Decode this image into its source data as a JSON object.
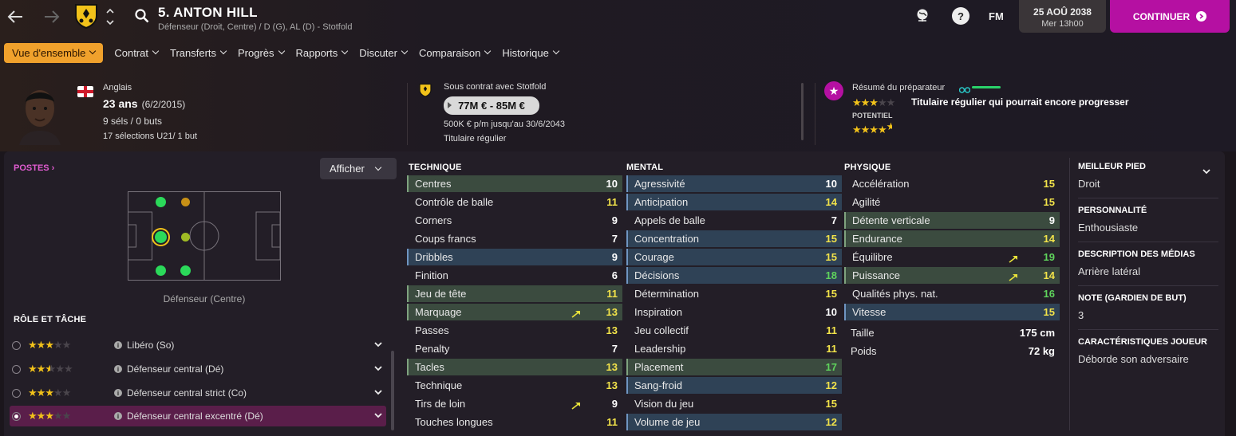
{
  "header": {
    "player_title": "5. ANTON HILL",
    "player_subtitle": "Défenseur (Droit, Centre) / D (G), AL (D) - Stotfold",
    "fm_label": "FM",
    "date": "25 AOÛ 2038",
    "day_time": "Mer 13h00",
    "continue_label": "CONTINUER"
  },
  "nav": {
    "tabs": [
      "Vue d'ensemble",
      "Contrat",
      "Transferts",
      "Progrès",
      "Rapports",
      "Discuter",
      "Comparaison",
      "Historique"
    ]
  },
  "profile": {
    "nationality": "Anglais",
    "age": "23 ans",
    "dob": "(6/2/2015)",
    "caps": "9 séls / 0 buts",
    "u21": "17 sélections U21/ 1 but"
  },
  "contract": {
    "club_line": "Sous contrat avec Stotfold",
    "value": "77M € - 85M €",
    "wage": "500K € p/m jusqu'au 30/6/2043",
    "status": "Titulaire régulier"
  },
  "coach": {
    "title": "Résumé du préparateur",
    "ability_stars": 3,
    "summary": "Titulaire régulier qui pourrait encore progresser",
    "potential_label": "POTENTIEL",
    "potential_stars": 4.5
  },
  "positions": {
    "title": "POSTES",
    "afficher": "Afficher",
    "position_label": "Défenseur (Centre)"
  },
  "roles": {
    "title": "RÔLE ET TÂCHE",
    "items": [
      {
        "name": "Libéro (So)",
        "stars": 3
      },
      {
        "name": "Défenseur central (Dé)",
        "stars": 2.5
      },
      {
        "name": "Défenseur central strict (Co)",
        "stars": 3
      },
      {
        "name": "Défenseur central excentré (Dé)",
        "stars": 3
      }
    ]
  },
  "technique": {
    "title": "TECHNIQUE",
    "attrs": [
      [
        "Centres",
        10,
        "g",
        false
      ],
      [
        "Contrôle de balle",
        11,
        "",
        false
      ],
      [
        "Corners",
        9,
        "",
        false
      ],
      [
        "Coups francs",
        7,
        "",
        false
      ],
      [
        "Dribbles",
        9,
        "b",
        false
      ],
      [
        "Finition",
        6,
        "",
        false
      ],
      [
        "Jeu de tête",
        11,
        "g",
        false
      ],
      [
        "Marquage",
        13,
        "g",
        true
      ],
      [
        "Passes",
        13,
        "",
        false
      ],
      [
        "Penalty",
        7,
        "",
        false
      ],
      [
        "Tacles",
        13,
        "g",
        false
      ],
      [
        "Technique",
        13,
        "",
        false
      ],
      [
        "Tirs de loin",
        9,
        "",
        true
      ],
      [
        "Touches longues",
        11,
        "",
        false
      ]
    ]
  },
  "mental": {
    "title": "MENTAL",
    "attrs": [
      [
        "Agressivité",
        10,
        "b",
        false
      ],
      [
        "Anticipation",
        14,
        "b",
        false
      ],
      [
        "Appels de balle",
        7,
        "",
        false
      ],
      [
        "Concentration",
        15,
        "b",
        false
      ],
      [
        "Courage",
        15,
        "b",
        false
      ],
      [
        "Décisions",
        18,
        "b",
        false
      ],
      [
        "Détermination",
        15,
        "",
        false
      ],
      [
        "Inspiration",
        10,
        "",
        false
      ],
      [
        "Jeu collectif",
        11,
        "",
        false
      ],
      [
        "Leadership",
        11,
        "",
        false
      ],
      [
        "Placement",
        17,
        "g",
        false
      ],
      [
        "Sang-froid",
        12,
        "b",
        false
      ],
      [
        "Vision du jeu",
        15,
        "",
        false
      ],
      [
        "Volume de jeu",
        12,
        "b",
        false
      ]
    ]
  },
  "physique": {
    "title": "PHYSIQUE",
    "attrs": [
      [
        "Accélération",
        15,
        "",
        false
      ],
      [
        "Agilité",
        15,
        "",
        false
      ],
      [
        "Détente verticale",
        9,
        "g",
        false
      ],
      [
        "Endurance",
        14,
        "g",
        false
      ],
      [
        "Équilibre",
        19,
        "",
        true
      ],
      [
        "Puissance",
        14,
        "g",
        true
      ],
      [
        "Qualités phys. nat.",
        16,
        "",
        false
      ],
      [
        "Vitesse",
        15,
        "b",
        false
      ]
    ],
    "height_label": "Taille",
    "height": "175 cm",
    "weight_label": "Poids",
    "weight": "72 kg"
  },
  "info": [
    {
      "title": "MEILLEUR PIED",
      "value": "Droit"
    },
    {
      "title": "PERSONNALITÉ",
      "value": "Enthousiaste"
    },
    {
      "title": "DESCRIPTION DES MÉDIAS",
      "value": "Arrière latéral"
    },
    {
      "title": "NOTE (GARDIEN DE BUT)",
      "value": "3"
    },
    {
      "title": "CARACTÉRISTIQUES JOUEUR",
      "value": "Déborde son adversaire"
    }
  ],
  "colors": {
    "accent": "#b510a2",
    "tab_active": "#f0a12c",
    "val_yellow": "#f2e34a",
    "val_green": "#5fd35c",
    "val_white": "#ffffff"
  }
}
